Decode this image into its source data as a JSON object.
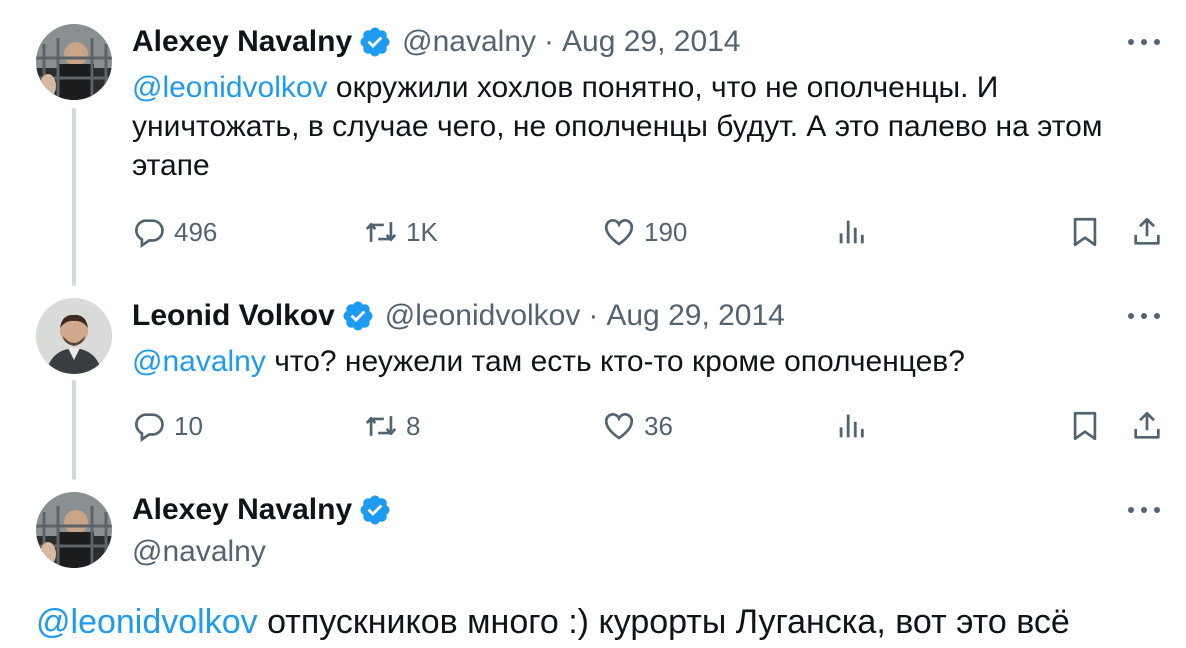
{
  "tweets": [
    {
      "name": "Alexey Navalny",
      "handle": "@navalny",
      "separator": "·",
      "date": "Aug 29, 2014",
      "mention": "@leonidvolkov",
      "text": " окружили хохлов понятно, что не ополченцы. И уничтожать, в случае чего, не ополченцы будут. А это палево на этом этапе",
      "replies": "496",
      "retweets": "1K",
      "likes": "190"
    },
    {
      "name": "Leonid Volkov",
      "handle": "@leonidvolkov",
      "separator": "·",
      "date": "Aug 29, 2014",
      "mention": "@navalny",
      "text": " что? неужели там есть кто-то кроме ополченцев?",
      "replies": "10",
      "retweets": "8",
      "likes": "36"
    }
  ],
  "main_tweet": {
    "name": "Alexey Navalny",
    "handle": "@navalny",
    "mention": "@leonidvolkov",
    "text": " отпускников много :) курорты Луганска, вот это всё"
  },
  "icons": {
    "verified": "verified-badge-icon",
    "more": "more-icon",
    "reply": "reply-icon",
    "retweet": "retweet-icon",
    "like": "heart-icon",
    "views": "views-icon",
    "bookmark": "bookmark-icon",
    "share": "share-icon"
  },
  "colors": {
    "accent": "#1d9bf0",
    "muted": "#536471",
    "text": "#0f1419",
    "thread_line": "#cfd9de"
  }
}
